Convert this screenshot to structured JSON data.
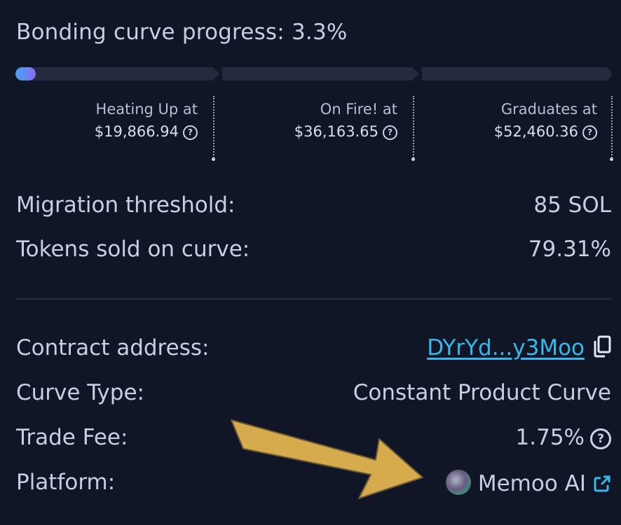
{
  "header": {
    "title": "Bonding curve progress: 3.3%"
  },
  "progress": {
    "fraction": 0.033
  },
  "milestones": [
    {
      "label": "Heating Up at",
      "value": "$19,866.94"
    },
    {
      "label": "On Fire! at",
      "value": "$36,163.65"
    },
    {
      "label": "Graduates at",
      "value": "$52,460.36"
    }
  ],
  "stats": {
    "migration_label": "Migration threshold:",
    "migration_value": "85 SOL",
    "tokens_label": "Tokens sold on curve:",
    "tokens_value": "79.31%"
  },
  "details": {
    "contract_label": "Contract address:",
    "contract_value": "DYrYd...y3Moo",
    "curve_label": "Curve Type:",
    "curve_value": "Constant Product Curve",
    "fee_label": "Trade Fee:",
    "fee_value": "1.75%",
    "platform_label": "Platform:",
    "platform_value": "Memoo AI"
  },
  "icons": {
    "help": "question-circle-icon",
    "copy": "copy-icon",
    "external": "external-link-icon"
  },
  "colors": {
    "background": "#111627",
    "accent_link": "#34b9ea",
    "progress_start": "#43a4f2",
    "progress_end": "#8b6cf3",
    "arrow": "#d5ab4e"
  }
}
